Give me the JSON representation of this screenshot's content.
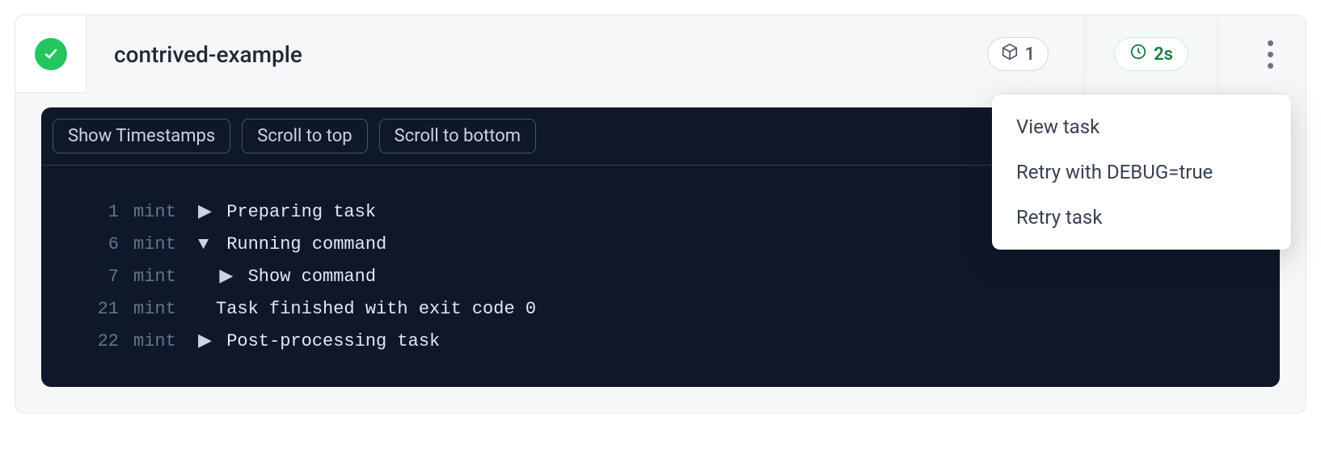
{
  "header": {
    "title": "contrived-example",
    "package_count": "1",
    "duration": "2s"
  },
  "toolbar": {
    "show_timestamps": "Show Timestamps",
    "scroll_top": "Scroll to top",
    "scroll_bottom": "Scroll to bottom"
  },
  "log": [
    {
      "n": "1",
      "tag": "mint",
      "caret": "▶",
      "indent": 0,
      "text": "Preparing task"
    },
    {
      "n": "6",
      "tag": "mint",
      "caret": "▼",
      "indent": 0,
      "text": "Running command"
    },
    {
      "n": "7",
      "tag": "mint",
      "caret": "▶",
      "indent": 1,
      "text": "Show command"
    },
    {
      "n": "21",
      "tag": "mint",
      "caret": "",
      "indent": 0,
      "text": "Task finished with exit code 0"
    },
    {
      "n": "22",
      "tag": "mint",
      "caret": "▶",
      "indent": 0,
      "text": "Post-processing task"
    }
  ],
  "menu": {
    "view_task": "View task",
    "retry_debug": "Retry with DEBUG=true",
    "retry_task": "Retry task"
  }
}
